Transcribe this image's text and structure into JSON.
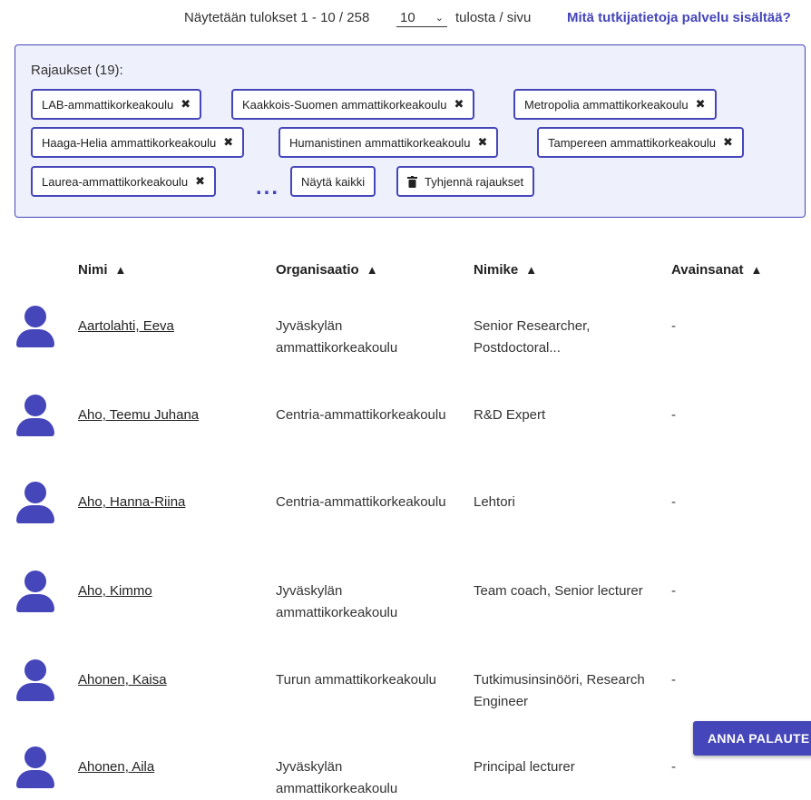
{
  "topbar": {
    "results_text": "Näytetään tulokset 1 - 10 / 258",
    "per_page_value": "10",
    "per_page_label": "tulosta / sivu",
    "info_link": "Mitä tutkijatietoja palvelu sisältää?"
  },
  "filters": {
    "title": "Rajaukset (19):",
    "chips": [
      "LAB-ammattikorkeakoulu",
      "Kaakkois-Suomen ammattikorkeakoulu",
      "Metropolia ammattikorkeakoulu",
      "Haaga-Helia ammattikorkeakoulu",
      "Humanistinen ammattikorkeakoulu",
      "Tampereen ammattikorkeakoulu",
      "Laurea-ammattikorkeakoulu"
    ],
    "more_dots": "...",
    "show_all": "Näytä kaikki",
    "clear_all": "Tyhjennä rajaukset"
  },
  "table": {
    "headers": {
      "name": "Nimi",
      "org": "Organisaatio",
      "title": "Nimike",
      "keywords": "Avainsanat"
    },
    "rows": [
      {
        "name": "Aartolahti, Eeva",
        "org": "Jyväskylän ammattikorkeakoulu",
        "title": "Senior Researcher, Postdoctoral...",
        "keywords": "-"
      },
      {
        "name": "Aho, Teemu Juhana",
        "org": "Centria-ammattikorkeakoulu",
        "title": "R&D Expert",
        "keywords": "-"
      },
      {
        "name": "Aho, Hanna-Riina",
        "org": "Centria-ammattikorkeakoulu",
        "title": "Lehtori",
        "keywords": "-"
      },
      {
        "name": "Aho, Kimmo",
        "org": "Jyväskylän ammattikorkeakoulu",
        "title": "Team coach, Senior lecturer",
        "keywords": "-"
      },
      {
        "name": "Ahonen, Kaisa",
        "org": "Turun ammattikorkeakoulu",
        "title": "Tutkimusinsinööri, Research Engineer",
        "keywords": "-"
      },
      {
        "name": "Ahonen, Aila",
        "org": "Jyväskylän ammattikorkeakoulu",
        "title": "Principal lecturer",
        "keywords": "-"
      }
    ]
  },
  "feedback_button": "ANNA PALAUTE",
  "icons": {
    "remove": "close-icon",
    "sort": "sort-icon",
    "trash": "trash-icon",
    "person": "person-icon",
    "chevron": "chevron-down-icon"
  },
  "colors": {
    "accent": "#4546b9",
    "panel_bg": "#eef0fb"
  }
}
